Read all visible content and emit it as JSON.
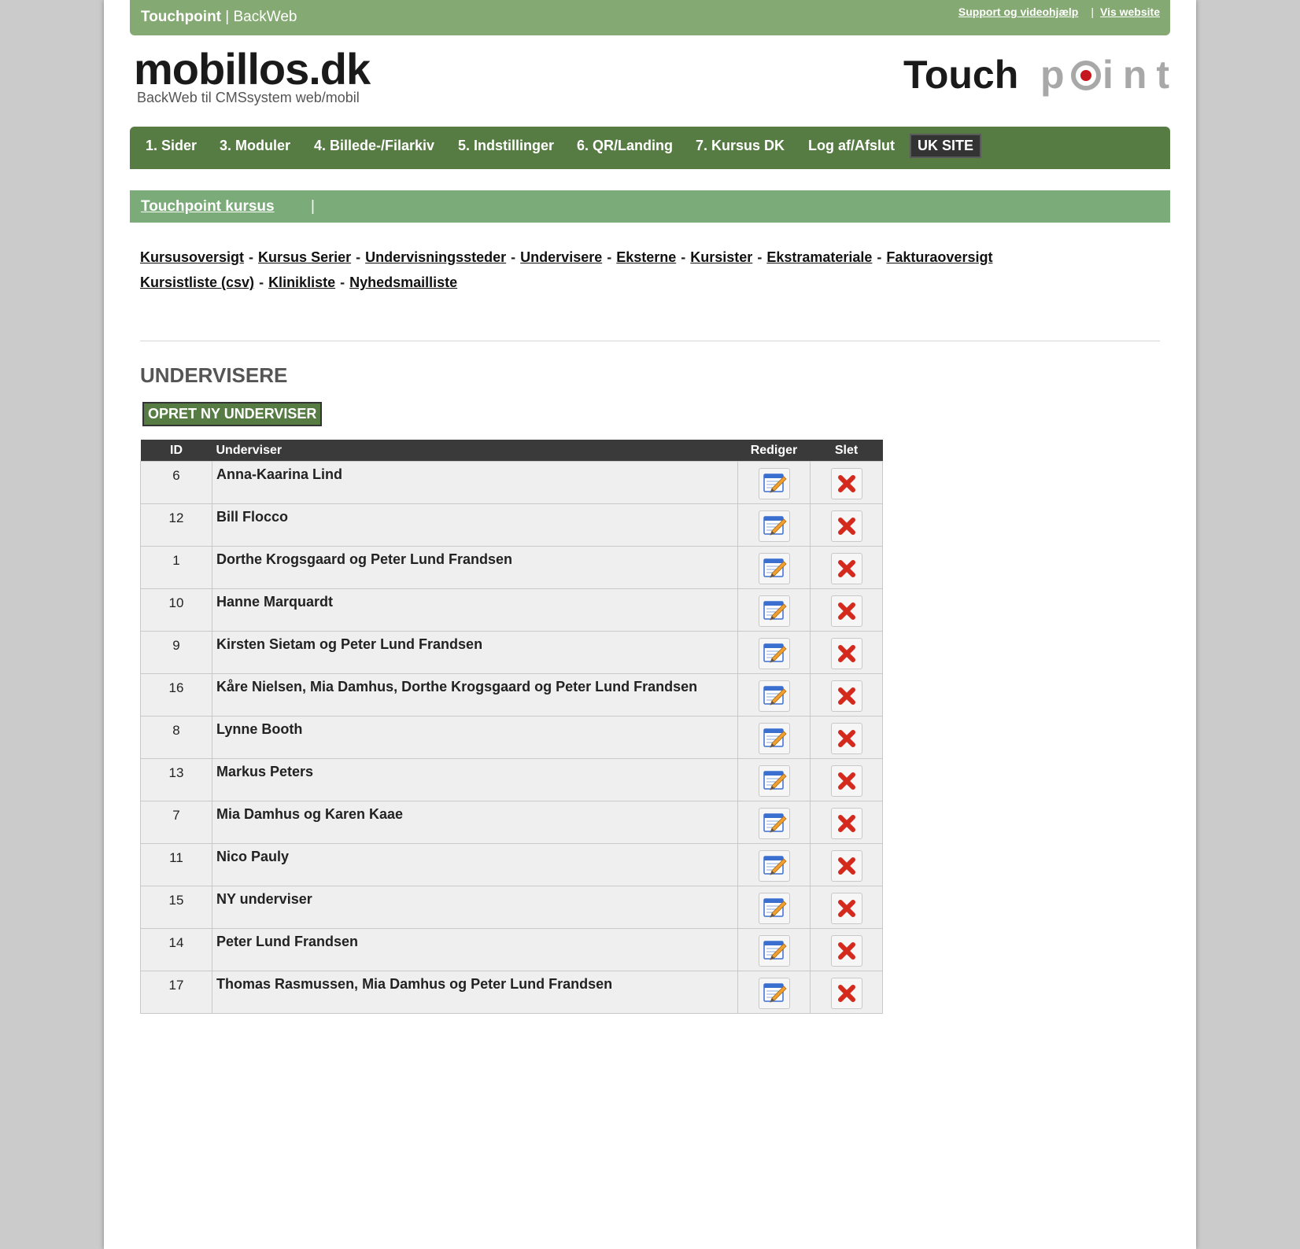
{
  "topbar": {
    "brand_bold": "Touchpoint",
    "brand_rest": " | BackWeb",
    "support_link": "Support og videohjælp",
    "separator": "|",
    "website_link": "Vis website"
  },
  "logo": {
    "main": "mobillos.dk",
    "sub": "BackWeb til CMSsystem web/mobil",
    "right_text_1": "Touch",
    "right_text_2": "p",
    "right_text_3": "int"
  },
  "nav": {
    "items": [
      {
        "label": "1. Sider"
      },
      {
        "label": "3. Moduler"
      },
      {
        "label": "4. Billede-/Filarkiv"
      },
      {
        "label": "5. Indstillinger"
      },
      {
        "label": "6. QR/Landing"
      },
      {
        "label": "7. Kursus DK"
      },
      {
        "label": "Log af/Afslut"
      }
    ],
    "uk_site": "UK SITE"
  },
  "subbar": {
    "link": "Touchpoint kursus",
    "pipe": "|"
  },
  "sublinks": {
    "row1": [
      "Kursusoversigt",
      "Kursus Serier",
      "Undervisningssteder",
      "Undervisere",
      "Eksterne",
      "Kursister",
      "Ekstramateriale",
      "Fakturaoversigt"
    ],
    "row2": [
      "Kursistliste (csv)",
      "Klinikliste",
      "Nyhedsmailliste"
    ],
    "dash": "-"
  },
  "page": {
    "heading": "UNDERVISERE",
    "create_button": "OPRET NY UNDERVISER"
  },
  "table": {
    "headers": {
      "id": "ID",
      "name": "Underviser",
      "edit": "Rediger",
      "delete": "Slet"
    },
    "rows": [
      {
        "id": "6",
        "name": "Anna-Kaarina Lind"
      },
      {
        "id": "12",
        "name": "Bill Flocco"
      },
      {
        "id": "1",
        "name": "Dorthe Krogsgaard og Peter Lund Frandsen"
      },
      {
        "id": "10",
        "name": "Hanne Marquardt"
      },
      {
        "id": "9",
        "name": "Kirsten Sietam og Peter Lund Frandsen"
      },
      {
        "id": "16",
        "name": "Kåre Nielsen, Mia Damhus, Dorthe Krogsgaard og Peter Lund Frandsen"
      },
      {
        "id": "8",
        "name": "Lynne Booth"
      },
      {
        "id": "13",
        "name": "Markus Peters"
      },
      {
        "id": "7",
        "name": "Mia Damhus og Karen Kaae"
      },
      {
        "id": "11",
        "name": "Nico Pauly"
      },
      {
        "id": "15",
        "name": "NY underviser"
      },
      {
        "id": "14",
        "name": "Peter Lund Frandsen"
      },
      {
        "id": "17",
        "name": "Thomas Rasmussen, Mia Damhus og Peter Lund Frandsen"
      }
    ]
  },
  "colors": {
    "topbar": "#85a972",
    "nav": "#567c44",
    "subbar": "#7aab78",
    "table_header": "#3a3a3a",
    "delete_red": "#d42a1e"
  },
  "icons": {
    "edit": "edit-icon",
    "delete": "delete-icon"
  }
}
